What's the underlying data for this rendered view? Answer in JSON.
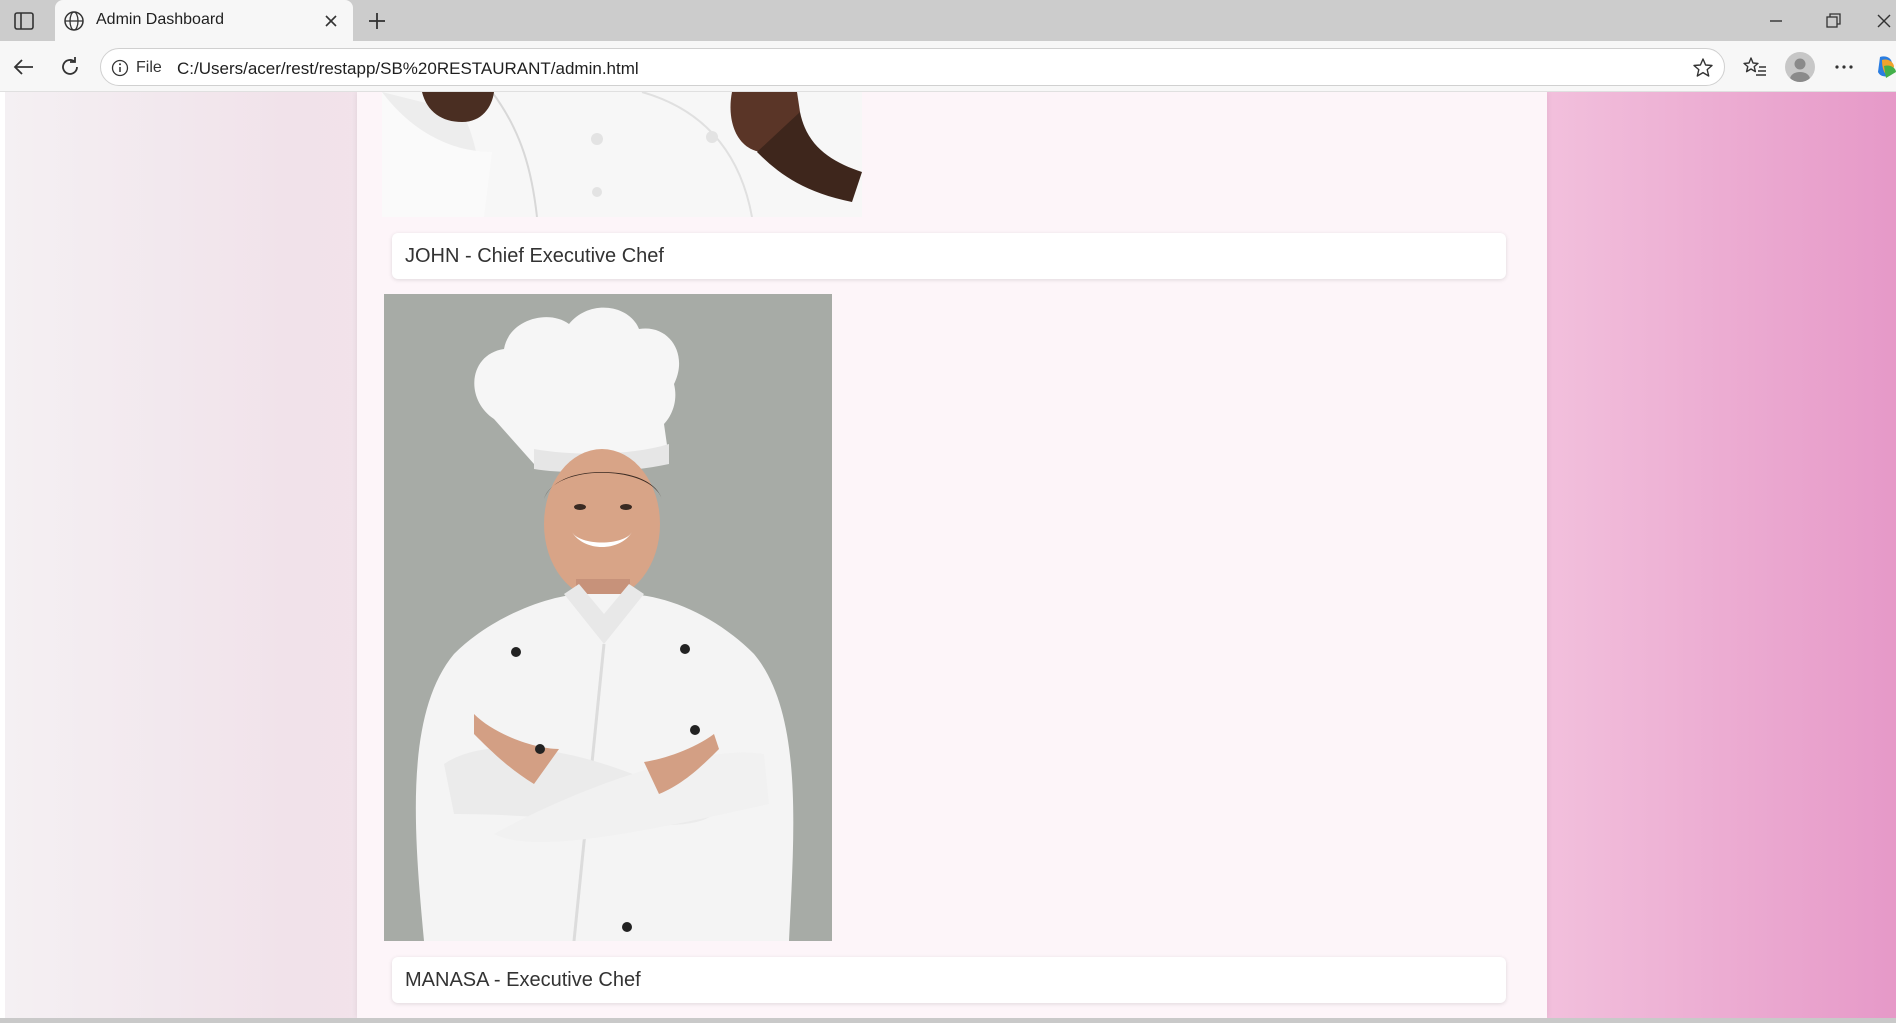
{
  "browser": {
    "tab_title": "Admin Dashboard",
    "address_scheme_label": "File",
    "address_url": "C:/Users/acer/rest/restapp/SB%20RESTAURANT/admin.html"
  },
  "icons": {
    "tab_actions": "tab-actions-icon",
    "globe": "globe-icon",
    "close": "close-icon",
    "new_tab": "plus-icon",
    "back": "back-arrow-icon",
    "reload": "reload-icon",
    "info": "info-icon",
    "favorite": "star-icon",
    "favorites_list": "favorites-icon",
    "more": "more-icon"
  },
  "colors": {
    "page_gradient_left": "#f4f0f3",
    "page_gradient_right": "#e699c8",
    "container_bg": "#fdf5f9"
  },
  "chefs": [
    {
      "caption": "JOHN - Chief Executive Chef"
    },
    {
      "caption": "MANASA - Executive Chef"
    }
  ]
}
